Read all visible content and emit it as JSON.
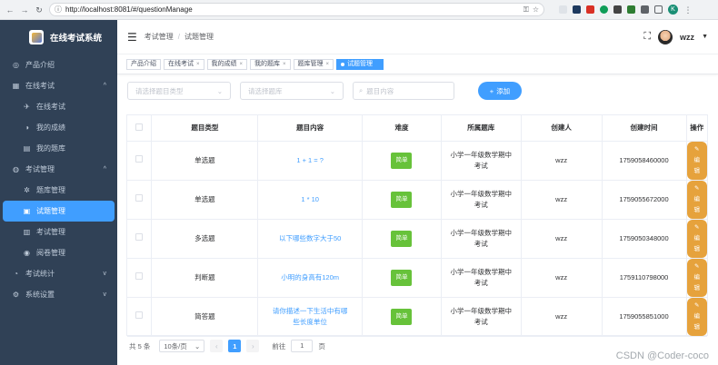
{
  "browser": {
    "url": "http://localhost:8081/#/questionManage",
    "profile_initial": "K"
  },
  "app": {
    "title": "在线考试系统"
  },
  "sidebar": {
    "items": [
      {
        "label": "产品介绍",
        "icon": "◎",
        "level": 0
      },
      {
        "label": "在线考试",
        "icon": "▦",
        "level": 0,
        "arrow": "^"
      },
      {
        "label": "在线考试",
        "icon": "✈",
        "level": 1
      },
      {
        "label": "我的成绩",
        "icon": "◑",
        "level": 1
      },
      {
        "label": "我的题库",
        "icon": "▤",
        "level": 1
      },
      {
        "label": "考试管理",
        "icon": "◍",
        "level": 0,
        "arrow": "^"
      },
      {
        "label": "题库管理",
        "icon": "✲",
        "level": 1
      },
      {
        "label": "试题管理",
        "icon": "▣",
        "level": 1,
        "active": true
      },
      {
        "label": "考试管理",
        "icon": "▥",
        "level": 1
      },
      {
        "label": "阅卷管理",
        "icon": "◉",
        "level": 1
      },
      {
        "label": "考试统计",
        "icon": "◔",
        "level": 0,
        "arrow": "v"
      },
      {
        "label": "系统设置",
        "icon": "⚙",
        "level": 0,
        "arrow": "v"
      }
    ]
  },
  "header": {
    "breadcrumb_1": "考试管理",
    "breadcrumb_sep": "/",
    "breadcrumb_2": "试题管理",
    "username": "wzz"
  },
  "tags": [
    {
      "label": "产品介绍",
      "close": false
    },
    {
      "label": "在线考试",
      "close": true
    },
    {
      "label": "我的成绩",
      "close": true
    },
    {
      "label": "我的题库",
      "close": true
    },
    {
      "label": "题库管理",
      "close": true
    },
    {
      "label": "试题管理",
      "close": true,
      "active": true
    }
  ],
  "filters": {
    "type_placeholder": "请选择题目类型",
    "bank_placeholder": "请选择题库",
    "content_placeholder": "题目内容",
    "add_label": "添加"
  },
  "table": {
    "headers": [
      "题目类型",
      "题目内容",
      "难度",
      "所属题库",
      "创建人",
      "创建时间",
      "操作"
    ],
    "rows": [
      {
        "type": "单选题",
        "content": "1 + 1 = ?",
        "difficulty": "简单",
        "bank": "小学一年级数学期中考试",
        "creator": "wzz",
        "time": "1759058460000",
        "action": "编辑"
      },
      {
        "type": "单选题",
        "content": "1 * 10",
        "difficulty": "简单",
        "bank": "小学一年级数学期中考试",
        "creator": "wzz",
        "time": "1759055672000",
        "action": "编辑"
      },
      {
        "type": "多选题",
        "content": "以下哪些数字大于50",
        "difficulty": "简单",
        "bank": "小学一年级数学期中考试",
        "creator": "wzz",
        "time": "1759050348000",
        "action": "编辑"
      },
      {
        "type": "判断题",
        "content": "小明的身高有120m",
        "difficulty": "简单",
        "bank": "小学一年级数学期中考试",
        "creator": "wzz",
        "time": "1759110798000",
        "action": "编辑"
      },
      {
        "type": "简答题",
        "content": "请你描述一下生活中有哪些长度单位",
        "difficulty": "简单",
        "bank": "小学一年级数学期中考试",
        "creator": "wzz",
        "time": "1759055851000",
        "action": "编辑"
      }
    ]
  },
  "pagination": {
    "total_text": "共 5 条",
    "page_size": "10条/页",
    "current_page": "1",
    "goto_label": "前往",
    "goto_value": "1",
    "page_suffix": "页"
  },
  "watermark": "CSDN @Coder-coco",
  "colors": {
    "sidebar_bg": "#304156",
    "primary": "#409eff",
    "success": "#67c23a",
    "warning": "#e6a23c"
  }
}
